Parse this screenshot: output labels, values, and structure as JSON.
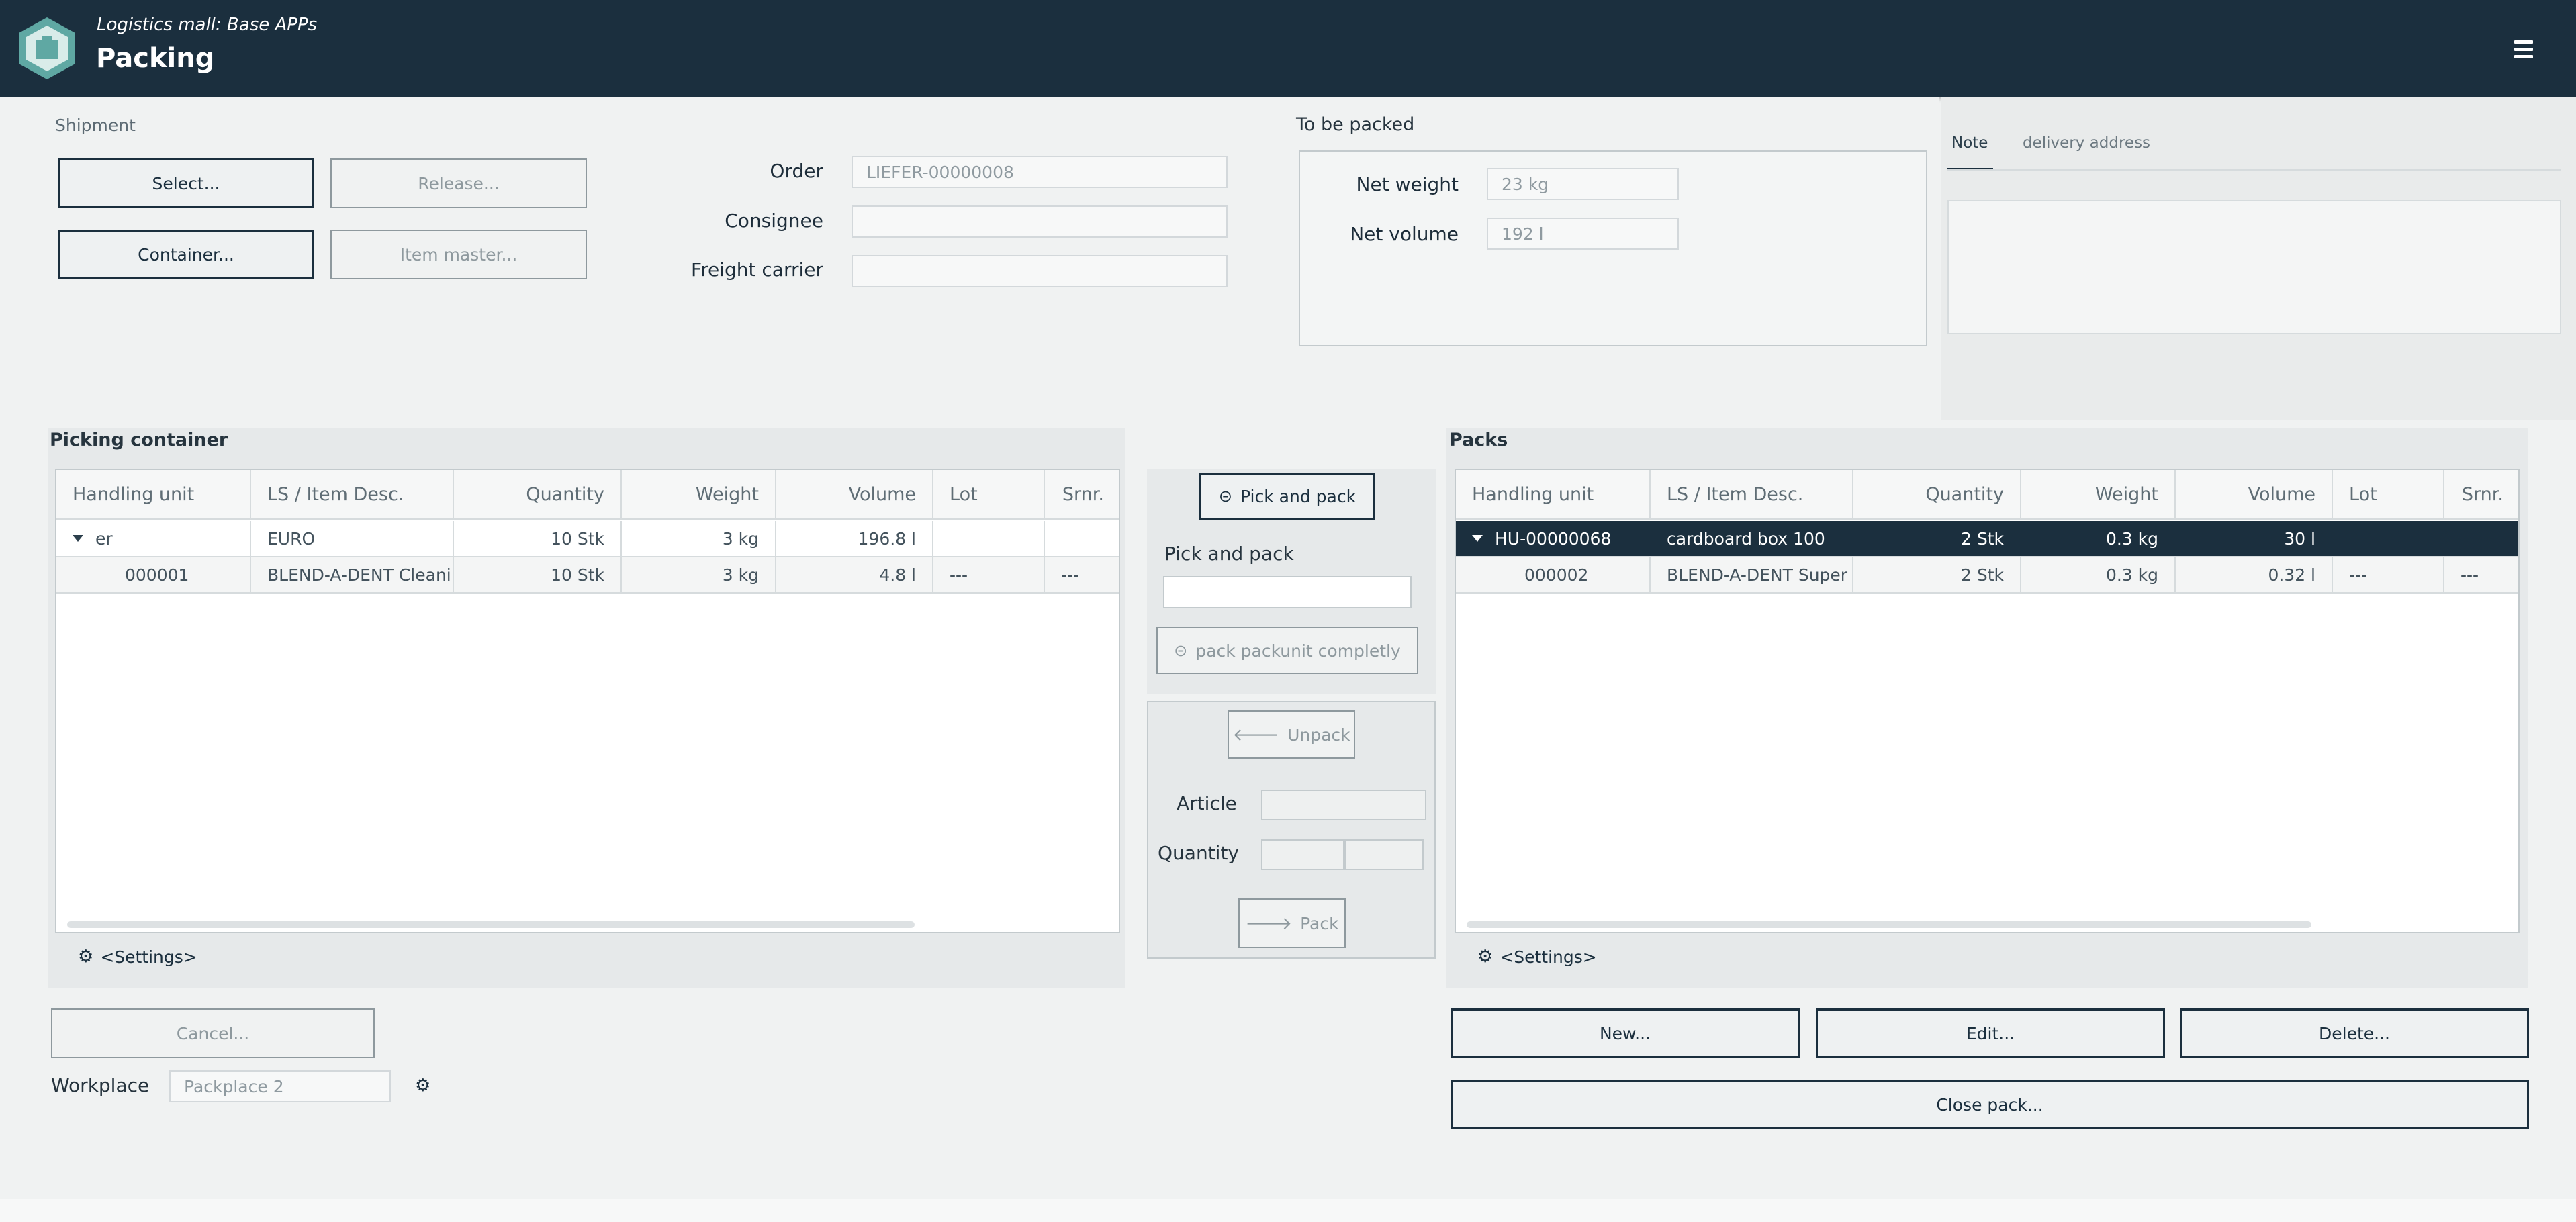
{
  "header": {
    "app_subtitle": "Logistics mall: Base APPs",
    "title": "Packing"
  },
  "shipment": {
    "label": "Shipment",
    "select_label": "Select...",
    "release_label": "Release...",
    "container_label": "Container...",
    "item_master_label": "Item master...",
    "order_label": "Order",
    "order_value": "LIEFER-00000008",
    "consignee_label": "Consignee",
    "consignee_value": "",
    "freight_label": "Freight carrier",
    "freight_value": ""
  },
  "to_be_packed": {
    "label": "To be packed",
    "net_weight_label": "Net weight",
    "net_weight_value": "23 kg",
    "net_volume_label": "Net volume",
    "net_volume_value": "192 l"
  },
  "tabs": [
    "Note",
    "delivery address"
  ],
  "picking": {
    "title": "Picking container",
    "columns": [
      "Handling unit",
      "LS / Item Desc.",
      "Quantity",
      "Weight",
      "Volume",
      "Lot",
      "Srnr."
    ],
    "rows": [
      [
        "er",
        "EURO",
        "10 Stk",
        "3 kg",
        "196.8 l",
        "",
        ""
      ],
      [
        "000001",
        "BLEND-A-DENT Cleaning",
        "10 Stk",
        "3 kg",
        "4.8 l",
        "---",
        "---"
      ]
    ],
    "settings_label": "<Settings>"
  },
  "middle": {
    "pick_and_pack_button": "Pick and pack",
    "pick_and_pack_label": "Pick and pack",
    "pick_and_pack_value": "",
    "pack_completely_label": "pack packunit completly",
    "unpack_label": "Unpack",
    "article_label": "Article",
    "quantity_label": "Quantity",
    "pack_label": "Pack"
  },
  "packs": {
    "title": "Packs",
    "columns": [
      "Handling unit",
      "LS / Item Desc.",
      "Quantity",
      "Weight",
      "Volume",
      "Lot",
      "Srnr."
    ],
    "rows": [
      [
        "HU-00000068",
        "cardboard box 100",
        "2 Stk",
        "0.3 kg",
        "30 l",
        "",
        ""
      ],
      [
        "000002",
        "BLEND-A-DENT Super Ac",
        "2 Stk",
        "0.3 kg",
        "0.32 l",
        "---",
        "---"
      ]
    ],
    "settings_label": "<Settings>",
    "new_label": "New...",
    "edit_label": "Edit...",
    "delete_label": "Delete...",
    "close_label": "Close pack..."
  },
  "footer": {
    "cancel_label": "Cancel...",
    "workplace_label": "Workplace",
    "workplace_value": "Packplace 2"
  },
  "colors": {
    "header_bg": "#1b2f3e",
    "selected_row": "#1b2f3e",
    "page_bg": "#f0f2f2"
  }
}
